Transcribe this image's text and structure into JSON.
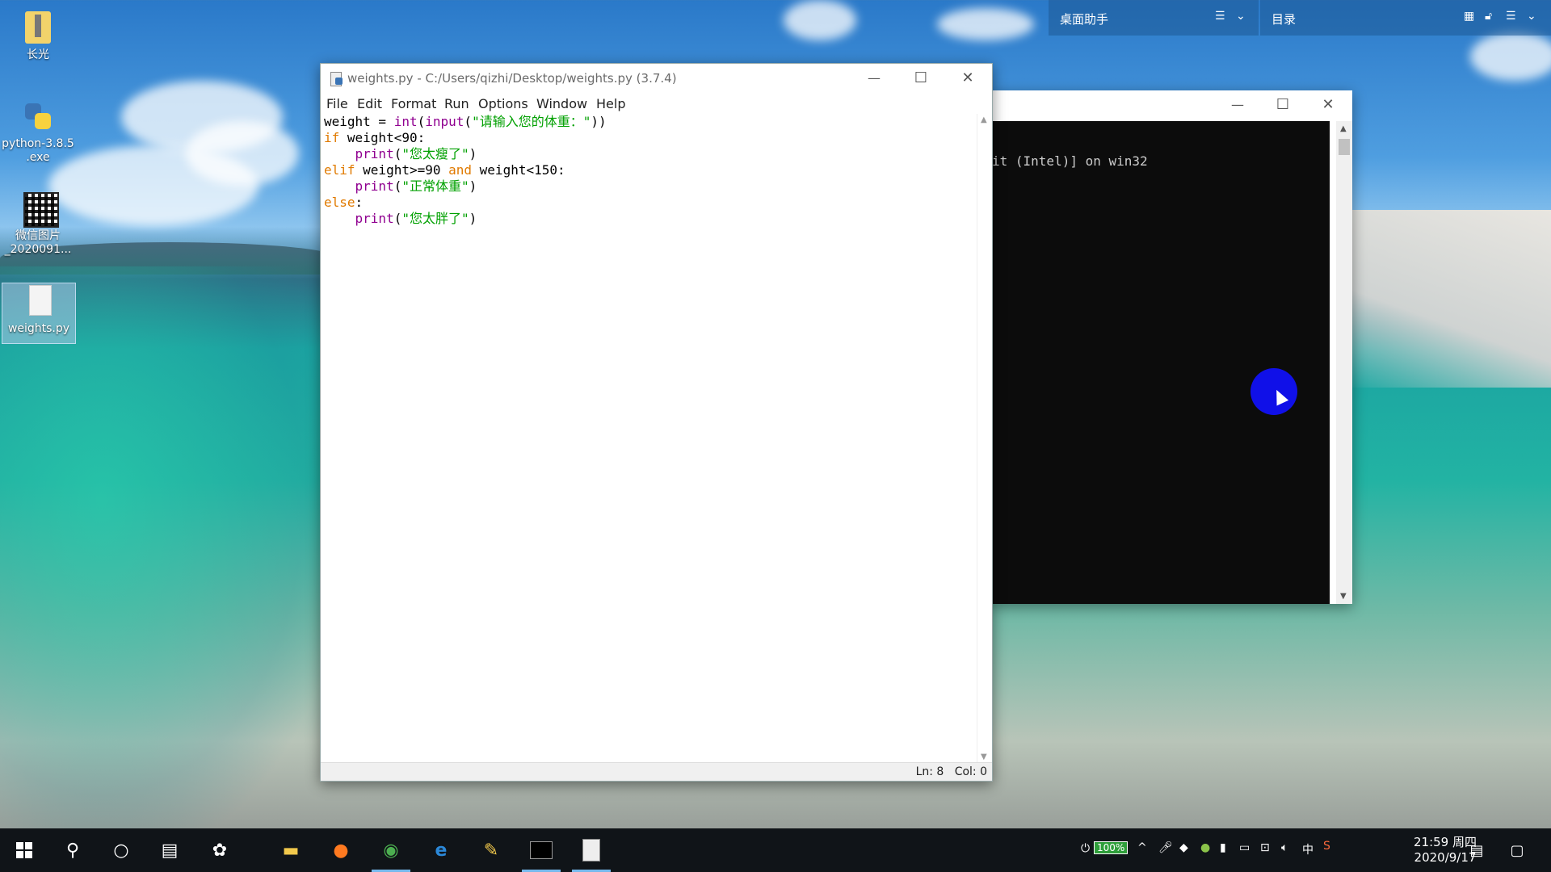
{
  "desktop": {
    "icons": [
      {
        "label": "长光"
      },
      {
        "label": "python-3.8.5\n.exe"
      },
      {
        "label": "微信图片\n_2020091..."
      },
      {
        "label": "weights.py"
      }
    ]
  },
  "helper_bar": {
    "left_title": "桌面助手",
    "right_title": "目录"
  },
  "idle_window": {
    "title": "weights.py - C:/Users/qizhi/Desktop/weights.py (3.7.4)",
    "menu": [
      "File",
      "Edit",
      "Format",
      "Run",
      "Options",
      "Window",
      "Help"
    ],
    "code_lines": [
      [
        {
          "t": "weight = ",
          "c": ""
        },
        {
          "t": "int",
          "c": "bi"
        },
        {
          "t": "(",
          "c": ""
        },
        {
          "t": "input",
          "c": "bi"
        },
        {
          "t": "(",
          "c": ""
        },
        {
          "t": "\"请输入您的体重：\"",
          "c": "st"
        },
        {
          "t": "))",
          "c": ""
        }
      ],
      [
        {
          "t": "if",
          "c": "kw"
        },
        {
          "t": " weight<90:",
          "c": ""
        }
      ],
      [
        {
          "t": "    ",
          "c": ""
        },
        {
          "t": "print",
          "c": "bi"
        },
        {
          "t": "(",
          "c": ""
        },
        {
          "t": "\"您太瘦了\"",
          "c": "st"
        },
        {
          "t": ")",
          "c": ""
        }
      ],
      [
        {
          "t": "elif",
          "c": "kw"
        },
        {
          "t": " weight>=90 ",
          "c": ""
        },
        {
          "t": "and",
          "c": "kw"
        },
        {
          "t": " weight<150:",
          "c": ""
        }
      ],
      [
        {
          "t": "    ",
          "c": ""
        },
        {
          "t": "print",
          "c": "bi"
        },
        {
          "t": "(",
          "c": ""
        },
        {
          "t": "\"正常体重\"",
          "c": "st"
        },
        {
          "t": ")",
          "c": ""
        }
      ],
      [
        {
          "t": "else",
          "c": "kw"
        },
        {
          "t": ":",
          "c": ""
        }
      ],
      [
        {
          "t": "    ",
          "c": ""
        },
        {
          "t": "print",
          "c": "bi"
        },
        {
          "t": "(",
          "c": ""
        },
        {
          "t": "\"您太胖了\"",
          "c": "st"
        },
        {
          "t": ")",
          "c": ""
        }
      ]
    ],
    "status": "Ln: 8   Col: 0"
  },
  "console_window": {
    "text": "it (Intel)] on win32"
  },
  "taskbar": {
    "battery": "100%",
    "ime": "中",
    "time": "21:59 周四",
    "date": "2020/9/17"
  },
  "colors": {
    "keyword": "#e07a00",
    "builtin": "#900090",
    "string": "#00a000",
    "taskbar": "#101418",
    "cursor_highlight": "#1010e8"
  }
}
